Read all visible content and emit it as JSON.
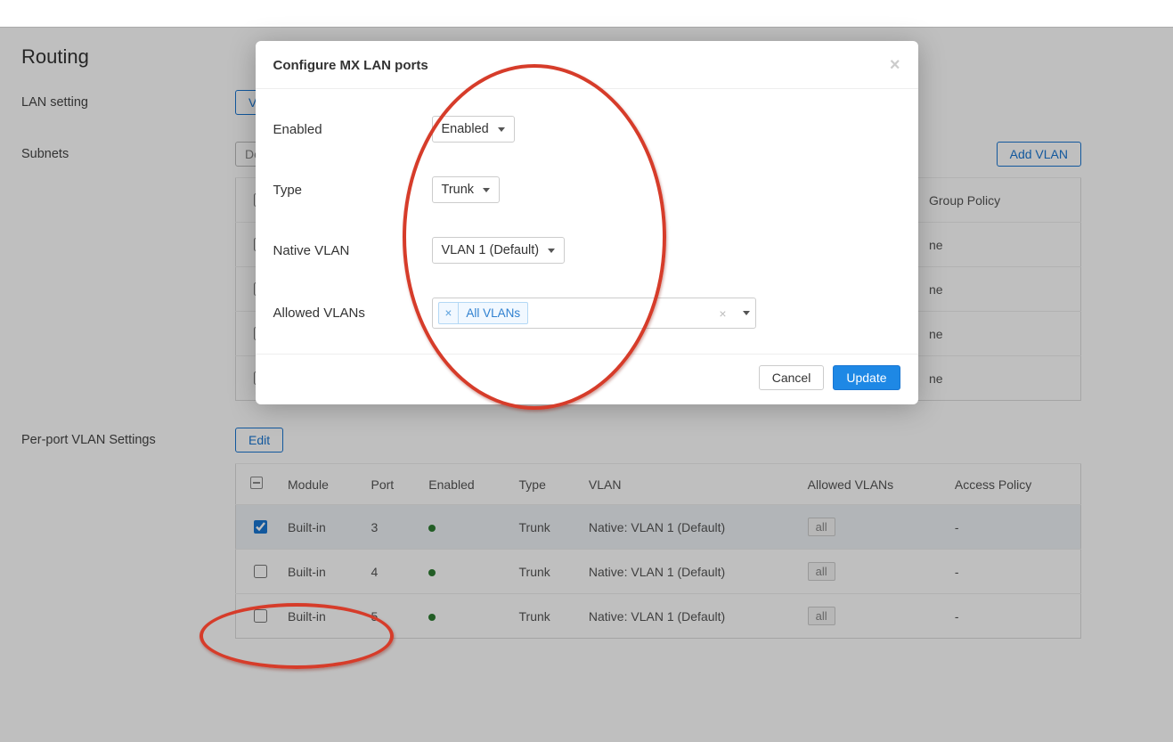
{
  "page": {
    "routing_title": "Routing",
    "lan_setting_label": "LAN setting",
    "vlan_button_visible_text": "VL",
    "subnets_label": "Subnets",
    "delete_button": "Delete",
    "add_vlan_button": "Add VLAN",
    "vlan_table_visible_headers": {
      "group_policy": "Group Policy"
    },
    "vlan_table_visible_cells": [
      "ne",
      "ne",
      "ne",
      "ne"
    ],
    "per_port_label": "Per-port VLAN Settings",
    "edit_button": "Edit",
    "port_table": {
      "headers": {
        "module": "Module",
        "port": "Port",
        "enabled": "Enabled",
        "type": "Type",
        "vlan": "VLAN",
        "allowed": "Allowed VLANs",
        "access_policy": "Access Policy"
      },
      "rows": [
        {
          "checked": true,
          "module": "Built-in",
          "port": "3",
          "type": "Trunk",
          "vlan": "Native: VLAN 1 (Default)",
          "allowed": "all",
          "access": "-"
        },
        {
          "checked": false,
          "module": "Built-in",
          "port": "4",
          "type": "Trunk",
          "vlan": "Native: VLAN 1 (Default)",
          "allowed": "all",
          "access": "-"
        },
        {
          "checked": false,
          "module": "Built-in",
          "port": "5",
          "type": "Trunk",
          "vlan": "Native: VLAN 1 (Default)",
          "allowed": "all",
          "access": "-"
        }
      ]
    }
  },
  "modal": {
    "title": "Configure MX LAN ports",
    "enabled_label": "Enabled",
    "enabled_value": "Enabled",
    "type_label": "Type",
    "type_value": "Trunk",
    "native_vlan_label": "Native VLAN",
    "native_vlan_value": "VLAN 1 (Default)",
    "allowed_vlans_label": "Allowed VLANs",
    "allowed_chip": "All VLANs",
    "cancel": "Cancel",
    "update": "Update"
  }
}
